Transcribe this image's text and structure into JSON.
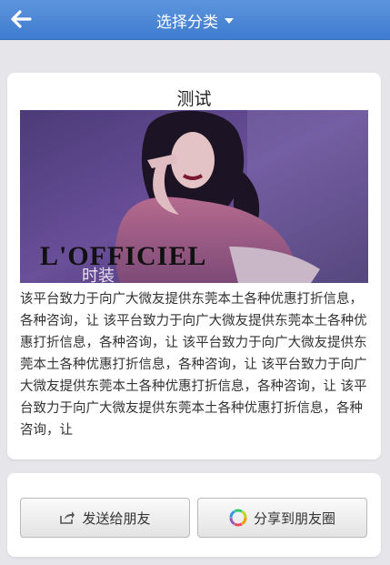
{
  "header": {
    "back_icon": "arrow-left-icon",
    "title": "选择分类",
    "bar_color": "#4a86d6"
  },
  "post": {
    "title": "测试",
    "image": {
      "overlay_brand": "L'OFFICIEL",
      "overlay_subtitle": "时装"
    },
    "description": "该平台致力于向广大微友提供东莞本土各种优惠打折信息，各种咨询，让 该平台致力于向广大微友提供东莞本土各种优惠打折信息，各种咨询，让 该平台致力于向广大微友提供东莞本土各种优惠打折信息，各种咨询，让 该平台致力于向广大微友提供东莞本土各种优惠打折信息，各种咨询，让 该平台致力于向广大微友提供东莞本土各种优惠打折信息，各种咨询，让"
  },
  "actions": {
    "send_label": "发送给朋友",
    "send_icon": "share-out-icon",
    "share_label": "分享到朋友圈",
    "share_icon": "moments-icon"
  }
}
